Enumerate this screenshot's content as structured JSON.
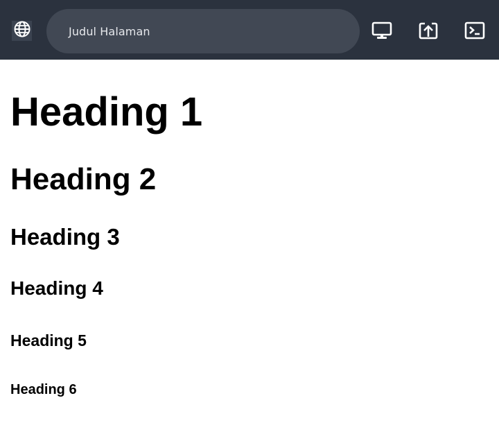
{
  "browser": {
    "address_bar_text": "Judul Halaman",
    "icons": {
      "left": "globe-icon",
      "desktop": "desktop-icon",
      "open_external": "open-external-icon",
      "terminal": "terminal-icon"
    },
    "colors": {
      "topbar_bg": "#2b323e",
      "address_bg": "#414854",
      "icon_color": "#ffffff"
    }
  },
  "page": {
    "headings": [
      {
        "level": 1,
        "text": "Heading 1"
      },
      {
        "level": 2,
        "text": "Heading 2"
      },
      {
        "level": 3,
        "text": "Heading 3"
      },
      {
        "level": 4,
        "text": "Heading 4"
      },
      {
        "level": 5,
        "text": "Heading 5"
      },
      {
        "level": 6,
        "text": "Heading 6"
      }
    ]
  }
}
